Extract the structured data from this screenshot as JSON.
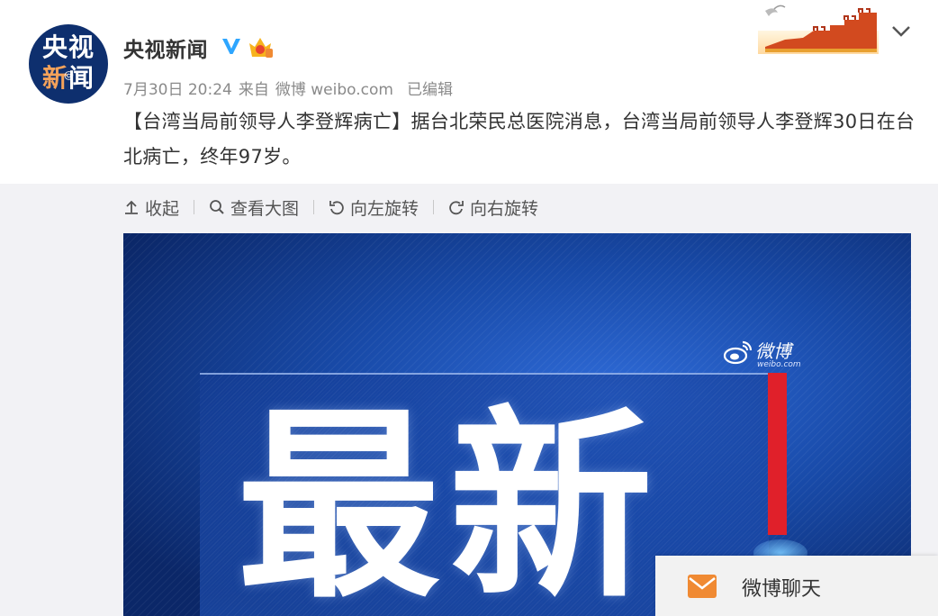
{
  "post": {
    "avatar": {
      "line1": "央视",
      "line2_a": "新",
      "line2_at": "@",
      "line2_b": "闻"
    },
    "username": "央视新闻",
    "date": "7月30日 20:24",
    "source_prefix": "来自",
    "source": "微博 weibo.com",
    "edited": "已编辑",
    "text": "【台湾当局前领导人李登辉病亡】据台北荣民总医院消息，台湾当局前领导人李登辉30日在台北病亡，终年97岁。",
    "expand_icon": "chevron-down-icon"
  },
  "toolbar": {
    "collapse": "收起",
    "view_large": "查看大图",
    "rotate_left": "向左旋转",
    "rotate_right": "向右旋转"
  },
  "image": {
    "headline": "最新",
    "watermark_name": "微博",
    "watermark_url": "weibo.com"
  },
  "chat": {
    "label": "微博聊天"
  },
  "colors": {
    "accent": "#e0202a",
    "image_blue": "#0c2c78",
    "verified": "#2ea6ff",
    "chat_icon": "#f08a33"
  }
}
